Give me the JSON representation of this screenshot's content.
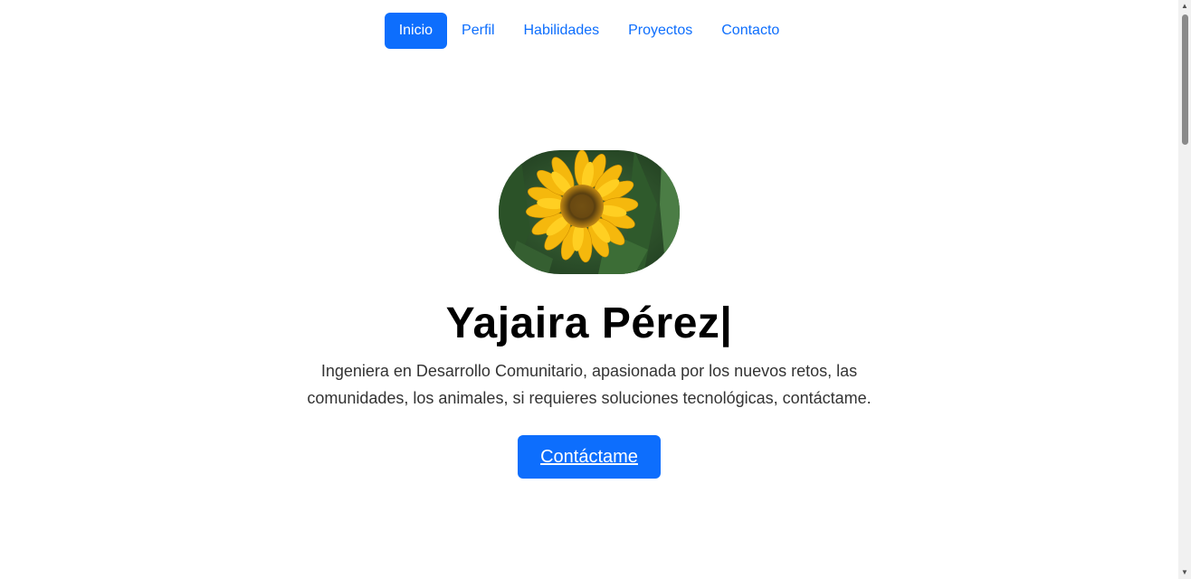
{
  "nav": {
    "items": [
      {
        "label": "Inicio",
        "active": true
      },
      {
        "label": "Perfil",
        "active": false
      },
      {
        "label": "Habilidades",
        "active": false
      },
      {
        "label": "Proyectos",
        "active": false
      },
      {
        "label": "Contacto",
        "active": false
      }
    ]
  },
  "hero": {
    "avatar_icon": "sunflower-photo",
    "name": "Yajaira Pérez|",
    "description": "Ingeniera en Desarrollo Comunitario, apasionada por los nuevos retos, las comunidades, los animales, si requieres soluciones tecnológicas, contáctame.",
    "cta_label": "Contáctame"
  },
  "colors": {
    "accent": "#0d6efd",
    "text": "#000000",
    "muted": "#333333"
  }
}
